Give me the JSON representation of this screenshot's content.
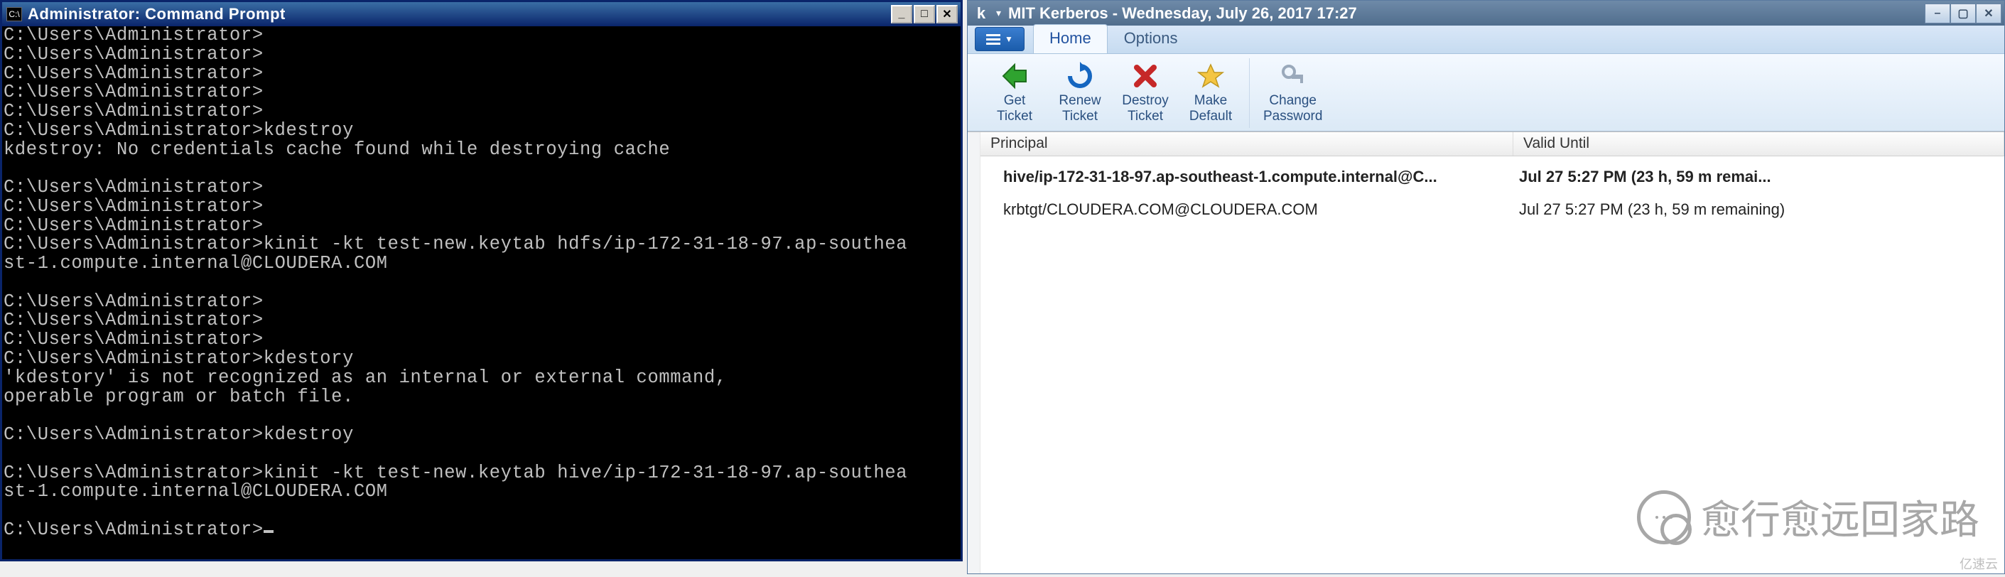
{
  "cmd": {
    "title": "Administrator: Command Prompt",
    "icon_name": "cmd-icon",
    "lines": [
      "C:\\Users\\Administrator>",
      "C:\\Users\\Administrator>",
      "C:\\Users\\Administrator>",
      "C:\\Users\\Administrator>",
      "C:\\Users\\Administrator>",
      "C:\\Users\\Administrator>kdestroy",
      "kdestroy: No credentials cache found while destroying cache",
      "",
      "C:\\Users\\Administrator>",
      "C:\\Users\\Administrator>",
      "C:\\Users\\Administrator>",
      "C:\\Users\\Administrator>kinit -kt test-new.keytab hdfs/ip-172-31-18-97.ap-southea",
      "st-1.compute.internal@CLOUDERA.COM",
      "",
      "C:\\Users\\Administrator>",
      "C:\\Users\\Administrator>",
      "C:\\Users\\Administrator>",
      "C:\\Users\\Administrator>kdestory",
      "'kdestory' is not recognized as an internal or external command,",
      "operable program or batch file.",
      "",
      "C:\\Users\\Administrator>kdestroy",
      "",
      "C:\\Users\\Administrator>kinit -kt test-new.keytab hive/ip-172-31-18-97.ap-southea",
      "st-1.compute.internal@CLOUDERA.COM",
      "",
      "C:\\Users\\Administrator>"
    ],
    "win_controls": {
      "min": "_",
      "max": "□",
      "close": "✕"
    }
  },
  "krb": {
    "title": "MIT Kerberos - Wednesday, July 26, 2017  17:27",
    "tabs": {
      "home": "Home",
      "options": "Options"
    },
    "ribbon": {
      "get_ticket": "Get Ticket",
      "renew_ticket": "Renew Ticket",
      "destroy_ticket": "Destroy Ticket",
      "make_default": "Make Default",
      "change_password": "Change Password"
    },
    "table": {
      "headers": {
        "principal": "Principal",
        "valid": "Valid Until"
      },
      "rows": [
        {
          "principal": "hive/ip-172-31-18-97.ap-southeast-1.compute.internal@C...",
          "valid": "Jul 27  5:27 PM (23 h, 59 m remai...",
          "bold": true
        },
        {
          "principal": "krbtgt/CLOUDERA.COM@CLOUDERA.COM",
          "valid": "Jul 27  5:27 PM (23 h, 59 m remaining)",
          "bold": false
        }
      ]
    },
    "win_controls": {
      "min": "–",
      "max": "▢",
      "close": "✕"
    }
  },
  "watermark_text": "愈行愈远回家路",
  "corner_logo": "亿速云"
}
